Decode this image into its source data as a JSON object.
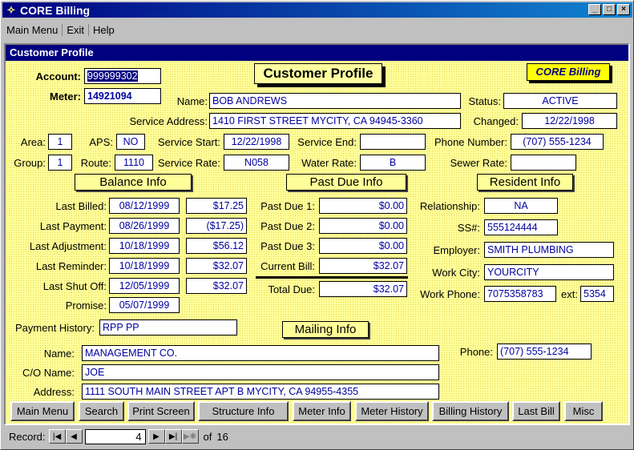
{
  "window": {
    "title": "CORE Billing",
    "buttons": {
      "min": "_",
      "max": "□",
      "close": "×"
    }
  },
  "menu": [
    {
      "label": "Main Menu"
    },
    {
      "label": "Exit"
    },
    {
      "label": "Help"
    }
  ],
  "child_title": "Customer Profile",
  "header": {
    "title": "Customer Profile",
    "badge": "CORE Billing"
  },
  "account": {
    "label": "Account:",
    "value": "999999302"
  },
  "meter": {
    "label": "Meter:",
    "value": "14921094"
  },
  "name": {
    "label": "Name:",
    "value": "BOB ANDREWS"
  },
  "status": {
    "label": "Status:",
    "value": "ACTIVE"
  },
  "service_address": {
    "label": "Service Address:",
    "value": "1410 FIRST STREET MYCITY, CA  94945-3360"
  },
  "changed": {
    "label": "Changed:",
    "value": "12/22/1998"
  },
  "area": {
    "label": "Area:",
    "value": "1"
  },
  "aps": {
    "label": "APS:",
    "value": "NO"
  },
  "service_start": {
    "label": "Service Start:",
    "value": "12/22/1998"
  },
  "service_end": {
    "label": "Service End:",
    "value": ""
  },
  "phone_number": {
    "label": "Phone Number:",
    "value": "(707) 555-1234"
  },
  "group": {
    "label": "Group:",
    "value": "1"
  },
  "route": {
    "label": "Route:",
    "value": "1110"
  },
  "service_rate": {
    "label": "Service Rate:",
    "value": "N058"
  },
  "water_rate": {
    "label": "Water Rate:",
    "value": "B"
  },
  "sewer_rate": {
    "label": "Sewer Rate:",
    "value": ""
  },
  "sections": {
    "balance": "Balance Info",
    "past_due": "Past Due Info",
    "resident": "Resident Info",
    "mailing": "Mailing Info"
  },
  "balance": {
    "last_billed": {
      "label": "Last Billed:",
      "date": "08/12/1999",
      "amount": "$17.25"
    },
    "last_payment": {
      "label": "Last Payment:",
      "date": "08/26/1999",
      "amount": "($17.25)"
    },
    "last_adjustment": {
      "label": "Last Adjustment:",
      "date": "10/18/1999",
      "amount": "$56.12"
    },
    "last_reminder": {
      "label": "Last Reminder:",
      "date": "10/18/1999",
      "amount": "$32.07"
    },
    "last_shut_off": {
      "label": "Last Shut Off:",
      "date": "12/05/1999",
      "amount": "$32.07"
    },
    "promise": {
      "label": "Promise:",
      "date": "05/07/1999"
    }
  },
  "past_due": {
    "pd1": {
      "label": "Past Due 1:",
      "value": "$0.00"
    },
    "pd2": {
      "label": "Past Due 2:",
      "value": "$0.00"
    },
    "pd3": {
      "label": "Past Due 3:",
      "value": "$0.00"
    },
    "current": {
      "label": "Current Bill:",
      "value": "$32.07"
    },
    "total": {
      "label": "Total Due:",
      "value": "$32.07"
    }
  },
  "resident": {
    "relationship": {
      "label": "Relationship:",
      "value": "NA"
    },
    "ssn": {
      "label": "SS#:",
      "value": "555124444"
    },
    "employer": {
      "label": "Employer:",
      "value": "SMITH PLUMBING"
    },
    "work_city": {
      "label": "Work City:",
      "value": "YOURCITY"
    },
    "work_phone": {
      "label": "Work Phone:",
      "value": "7075358783"
    },
    "ext": {
      "label": "ext:",
      "value": "5354"
    }
  },
  "payment_history": {
    "label": "Payment History:",
    "value": "RPP PP"
  },
  "mailing": {
    "name": {
      "label": "Name:",
      "value": "MANAGEMENT CO."
    },
    "co_name": {
      "label": "C/O Name:",
      "value": "JOE"
    },
    "address": {
      "label": "Address:",
      "value": "1111 SOUTH MAIN STREET APT B MYCITY, CA  94955-4355"
    },
    "phone": {
      "label": "Phone:",
      "value": "(707) 555-1234"
    }
  },
  "buttons": [
    "Main Menu",
    "Search",
    "Print Screen",
    "Structure Info",
    "Meter Info",
    "Meter History",
    "Billing History",
    "Last Bill",
    "Misc"
  ],
  "record": {
    "label": "Record:",
    "current": "4",
    "of_label": "of",
    "total": "16"
  },
  "colors": {
    "form_bg": "#ffff99",
    "title_bar": "#000080",
    "field_text": "#0000a0"
  }
}
